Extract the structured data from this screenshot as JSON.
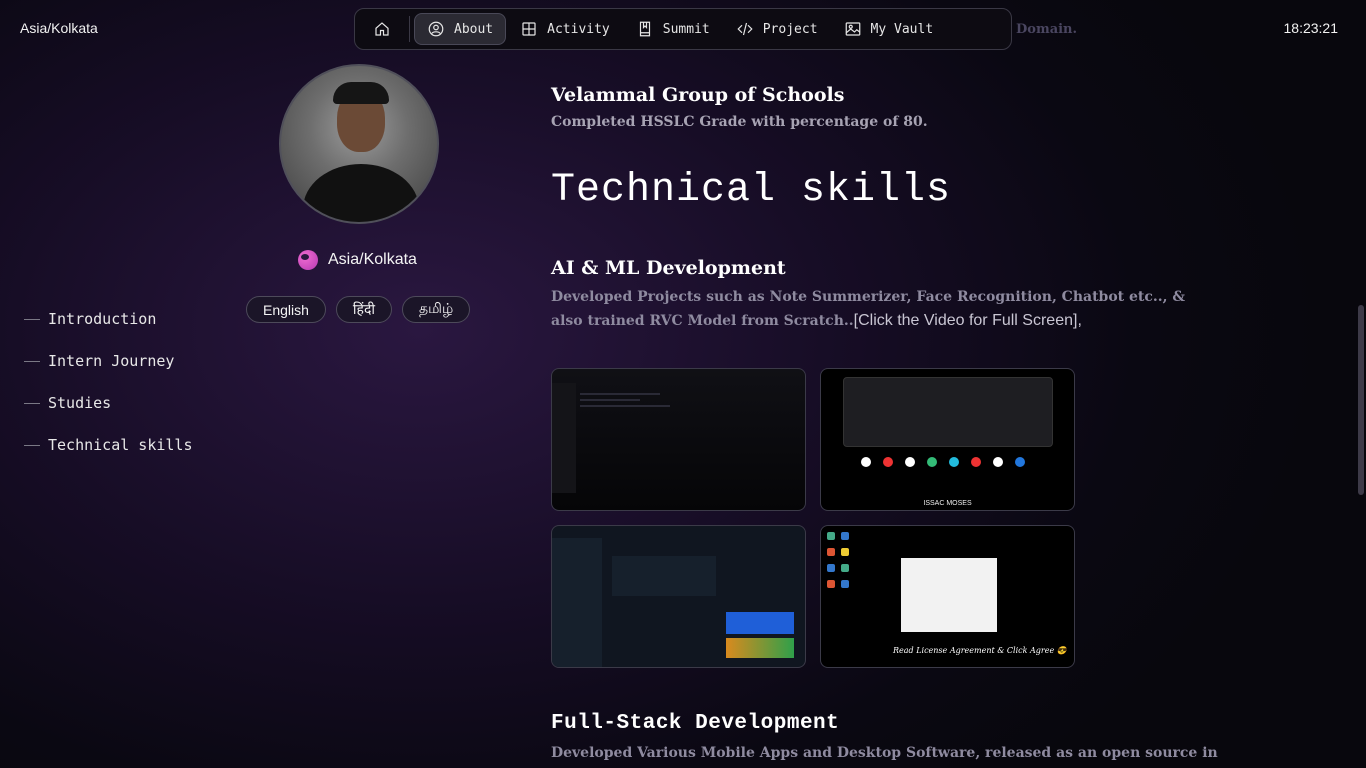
{
  "header": {
    "timezone": "Asia/Kolkata",
    "clock": "18:23:21",
    "faded_text": "Domain."
  },
  "nav": {
    "home_icon": "home-icon",
    "items": [
      {
        "label": "About",
        "icon": "user-circle-icon",
        "active": true
      },
      {
        "label": "Activity",
        "icon": "grid-icon",
        "active": false
      },
      {
        "label": "Summit",
        "icon": "book-icon",
        "active": false
      },
      {
        "label": "Project",
        "icon": "code-icon",
        "active": false
      },
      {
        "label": "My Vault",
        "icon": "image-icon",
        "active": false
      }
    ]
  },
  "profile": {
    "location": "Asia/Kolkata",
    "languages": [
      "English",
      "हिंदी",
      "தமிழ்"
    ]
  },
  "toc": [
    "Introduction",
    "Intern Journey",
    "Studies",
    "Technical skills"
  ],
  "content": {
    "school_name": "Velammal Group of Schools",
    "school_desc": "Completed HSSLC Grade with percentage of 80.",
    "section_title": "Technical skills",
    "ai_title": "AI & ML Development",
    "ai_desc_bold": "Developed Projects such as Note Summerizer, Face Recognition, Chatbot etc.., & also trained RVC Model from Scratch..",
    "ai_desc_plain": "[Click the Video for Full Screen],",
    "shot2_caption": "ISSAC MOSES",
    "shot4_caption": "Read License Agreement & Click Agree 😎",
    "fs_title": "Full-Stack Development",
    "fs_desc": "Developed Various Mobile Apps and Desktop Software, released as an open source in"
  },
  "colors": {
    "accent_globe": "#f06bd1",
    "active_nav": "#2b2a33"
  }
}
